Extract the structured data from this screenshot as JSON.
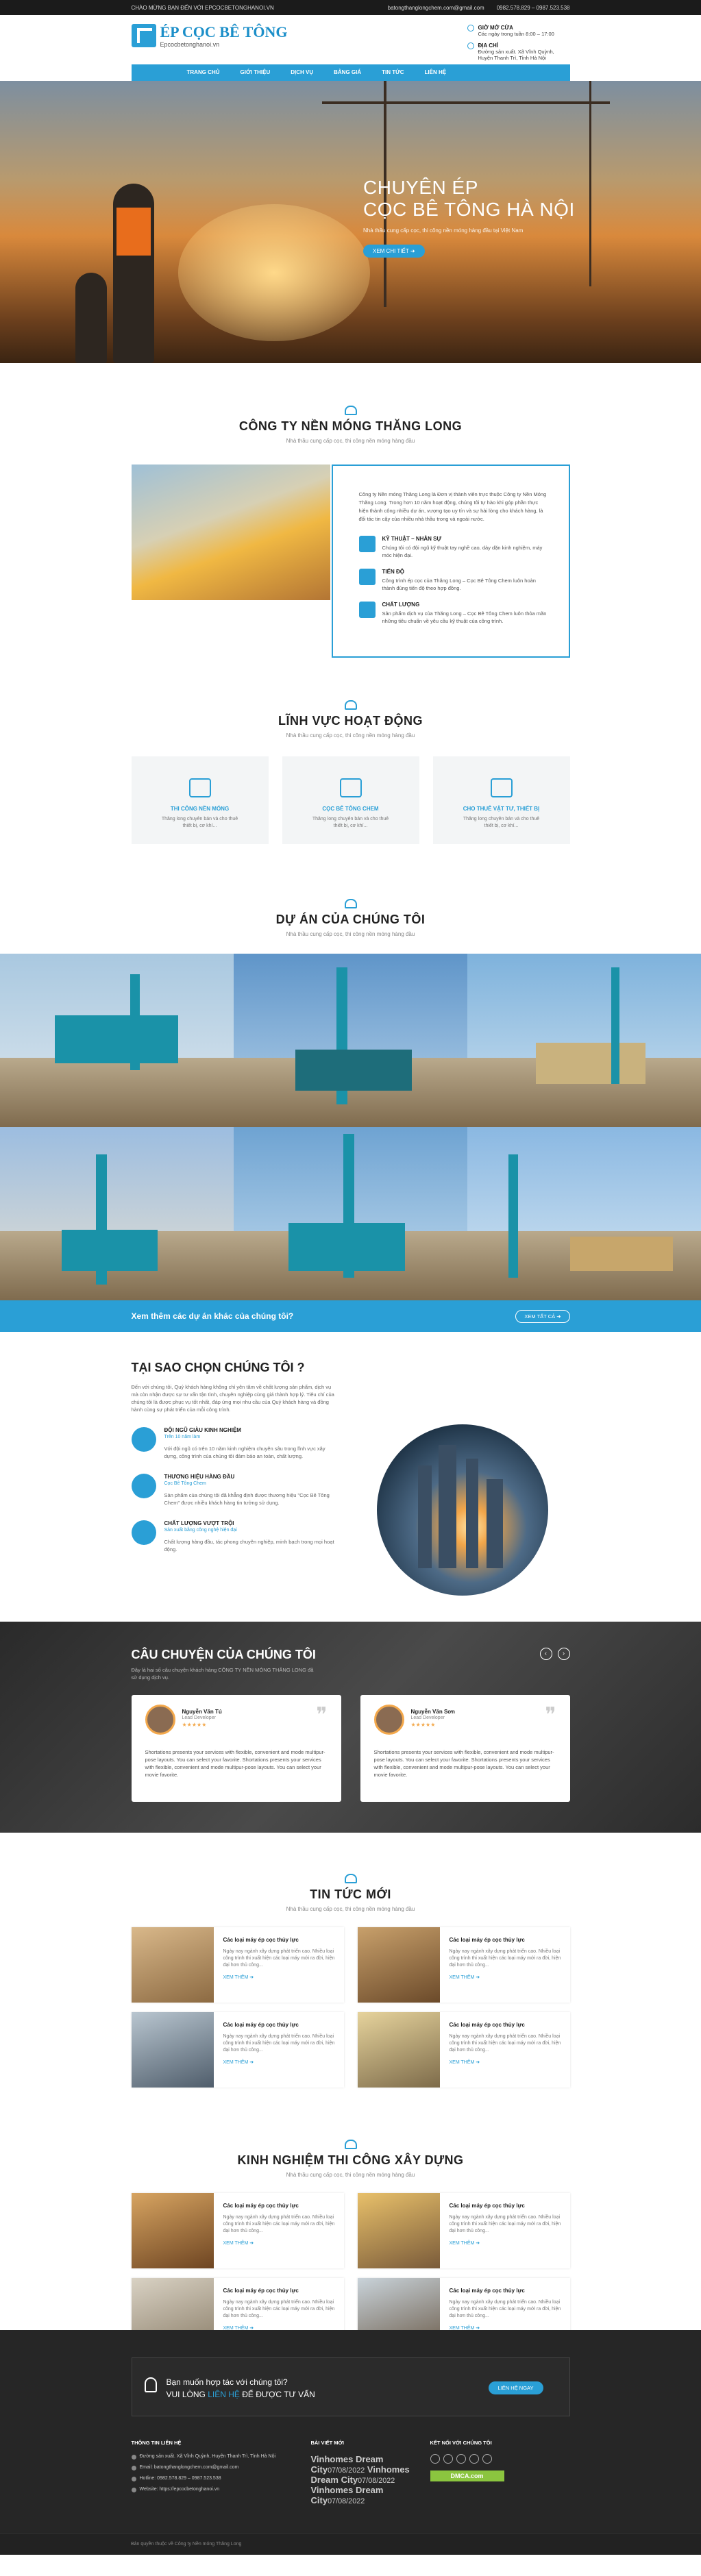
{
  "topbar": {
    "welcome": "CHÀO MỪNG BẠN ĐẾN VỚI EPCOCBETONGHANOI.VN",
    "email": "batongthanglongchem.com@gmail.com",
    "phone": "0982.578.829 – 0987.523.538"
  },
  "header": {
    "logo_title": "ÉP CỌC BÊ TÔNG",
    "logo_sub": "Epcocbetonghanoi.vn",
    "hours_title": "GIỜ MỞ CỬA",
    "hours_text": "Các ngày trong tuần 8:00 – 17:00",
    "address_title": "ĐỊA CHỈ",
    "address_text": "Đường sản xuất. Xã Vĩnh Quỳnh, Huyện Thanh Trì, Tỉnh Hà Nội"
  },
  "nav": [
    "TRANG CHỦ",
    "GIỚI THIỆU",
    "DỊCH VỤ",
    "BẢNG GIÁ",
    "TIN TỨC",
    "LIÊN HỆ"
  ],
  "hero": {
    "title_line1": "CHUYÊN ÉP",
    "title_line2": "CỌC BÊ TÔNG HÀ NỘI",
    "subtitle": "Nhà thầu cung cấp cọc, thi công nền móng hàng đầu tại Việt Nam",
    "button": "XEM CHI TIẾT ➜"
  },
  "about": {
    "title": "CÔNG TY NỀN MÓNG THĂNG LONG",
    "subtitle": "Nhà thầu cung cấp cọc, thi công nền móng hàng đầu",
    "intro": "Công ty Nền móng Thăng Long là Đơn vị thành viên trực thuộc Công ty Nền Móng Thăng Long. Trong hơn 10 năm hoạt động, chúng tôi tự hào khi góp phần thực hiện thành công nhiều dự án, vượng tạo uy tín và sự hài lòng cho khách hàng, là đối tác tin cậy của nhiều nhà thầu trong và ngoài nước.",
    "features": [
      {
        "title": "KỸ THUẬT – NHÂN SỰ",
        "text": "Chúng tôi có đội ngũ kỹ thuật tay nghề cao, dày dặn kinh nghiệm, máy móc hiện đại."
      },
      {
        "title": "TIẾN ĐỘ",
        "text": "Công trình ép cọc của Thăng Long – Cọc Bê Tông Chem luôn hoàn thành đúng tiến độ theo hợp đồng."
      },
      {
        "title": "CHẤT LƯỢNG",
        "text": "Sản phẩm dịch vụ của Thăng Long – Cọc Bê Tông Chem luôn thỏa mãn những tiêu chuẩn về yêu cầu kỹ thuật của công trình."
      }
    ]
  },
  "fields": {
    "title": "LĨNH VỰC HOẠT ĐỘNG",
    "subtitle": "Nhà thầu cung cấp cọc, thi công nền móng hàng đầu",
    "cards": [
      {
        "title": "THI CÔNG NỀN MÓNG",
        "text": "Thăng long chuyên bán và cho thuê thiết bị, cơ khí..."
      },
      {
        "title": "CỌC BÊ TÔNG CHEM",
        "text": "Thăng long chuyên bán và cho thuê thiết bị, cơ khí..."
      },
      {
        "title": "CHO THUÊ VẬT TƯ, THIẾT BỊ",
        "text": "Thăng long chuyên bán và cho thuê thiết bị, cơ khí..."
      }
    ]
  },
  "projects": {
    "title": "DỰ ÁN CỦA CHÚNG TÔI",
    "subtitle": "Nhà thầu cung cấp cọc, thi công nền móng hàng đầu",
    "more_text": "Xem thêm các dự án khác của chúng tôi?",
    "more_button": "XEM TẤT CẢ ➜"
  },
  "why": {
    "title": "TẠI SAO CHỌN CHÚNG TÔI ?",
    "lead": "Đến với chúng tôi, Quý khách hàng không chỉ yên tâm về chất lượng sản phẩm, dịch vụ mà còn nhận được sự tư vấn tận tình, chuyên nghiệp cùng giá thành hợp lý. Tiêu chí của chúng tôi là được phục vụ tốt nhất, đáp ứng mọi nhu cầu của Quý khách hàng và đồng hành cùng sự phát triển của mỗi công trình.",
    "reasons": [
      {
        "title": "ĐỘI NGŨ GIÀU KINH NGHIỆM",
        "tag": "Trên 10 năm làm",
        "text": "Với đội ngũ có trên 10 năm kinh nghiệm chuyên sâu trong lĩnh vực xây dựng, công trình của chúng tôi đảm bảo an toàn, chất lượng."
      },
      {
        "title": "THƯƠNG HIỆU HÀNG ĐẦU",
        "tag": "Cọc Bê Tông Chem",
        "text": "Sản phẩm của chúng tôi đã khẳng định được thương hiệu \"Cọc Bê Tông Chem\" được nhiều khách hàng tin tưởng sử dụng."
      },
      {
        "title": "CHẤT LƯỢNG VƯỢT TRỘI",
        "tag": "Sản xuất bằng công nghệ hiện đại",
        "text": "Chất lượng hàng đầu, tác phong chuyên nghiệp, minh bạch trong mọi hoạt động."
      }
    ]
  },
  "testimonials": {
    "title": "CÂU CHUYỆN CỦA CHÚNG TÔI",
    "lead": "Đây là hai số câu chuyện khách hàng CÔNG TY NỀN MÓNG THĂNG LONG đã sử dụng dịch vụ.",
    "items": [
      {
        "name": "Nguyễn Văn Tú",
        "role": "Lead Developer",
        "stars": "★★★★★",
        "text": "Shortations presents your services with flexible, convenient and mode multipur-pose layouts. You can select your favorite. Shortations presents your services with flexible, convenient and mode multipur-pose layouts. You can select your movie favorite."
      },
      {
        "name": "Nguyễn Văn Sơn",
        "role": "Lead Developer",
        "stars": "★★★★★",
        "text": "Shortations presents your services with flexible, convenient and mode multipur-pose layouts. You can select your favorite. Shortations presents your services with flexible, convenient and mode multipur-pose layouts. You can select your movie favorite."
      }
    ]
  },
  "news": {
    "title": "TIN TỨC MỚI",
    "subtitle": "Nhà thầu cung cấp cọc, thi công nền móng hàng đầu",
    "items": [
      {
        "title": "Các loại máy ép cọc thủy lực",
        "text": "Ngày nay ngành xây dựng phát triển cao. Nhiều loại công trình thi xuất hiện các loại máy mới ra đời, hiện đại hơn thủ công...",
        "link": "XEM THÊM ➜"
      },
      {
        "title": "Các loại máy ép cọc thủy lực",
        "text": "Ngày nay ngành xây dựng phát triển cao. Nhiều loại công trình thi xuất hiện các loại máy mới ra đời, hiện đại hơn thủ công...",
        "link": "XEM THÊM ➜"
      },
      {
        "title": "Các loại máy ép cọc thủy lực",
        "text": "Ngày nay ngành xây dựng phát triển cao. Nhiều loại công trình thi xuất hiện các loại máy mới ra đời, hiện đại hơn thủ công...",
        "link": "XEM THÊM ➜"
      },
      {
        "title": "Các loại máy ép cọc thủy lực",
        "text": "Ngày nay ngành xây dựng phát triển cao. Nhiều loại công trình thi xuất hiện các loại máy mới ra đời, hiện đại hơn thủ công...",
        "link": "XEM THÊM ➜"
      }
    ]
  },
  "experience": {
    "title": "KINH NGHIỆM THI CÔNG XÂY DỰNG",
    "subtitle": "Nhà thầu cung cấp cọc, thi công nền móng hàng đầu",
    "items": [
      {
        "title": "Các loại máy ép cọc thủy lực",
        "text": "Ngày nay ngành xây dựng phát triển cao. Nhiều loại công trình thi xuất hiện các loại máy mới ra đời, hiện đại hơn thủ công...",
        "link": "XEM THÊM ➜"
      },
      {
        "title": "Các loại máy ép cọc thủy lực",
        "text": "Ngày nay ngành xây dựng phát triển cao. Nhiều loại công trình thi xuất hiện các loại máy mới ra đời, hiện đại hơn thủ công...",
        "link": "XEM THÊM ➜"
      },
      {
        "title": "Các loại máy ép cọc thủy lực",
        "text": "Ngày nay ngành xây dựng phát triển cao. Nhiều loại công trình thi xuất hiện các loại máy mới ra đời, hiện đại hơn thủ công...",
        "link": "XEM THÊM ➜"
      },
      {
        "title": "Các loại máy ép cọc thủy lực",
        "text": "Ngày nay ngành xây dựng phát triển cao. Nhiều loại công trình thi xuất hiện các loại máy mới ra đời, hiện đại hơn thủ công...",
        "link": "XEM THÊM ➜"
      }
    ]
  },
  "footer": {
    "cta_line1": "Bạn muốn hợp tác với chúng tôi?",
    "cta_line2_pre": "VUI LÒNG ",
    "cta_line2_hl": "LIÊN HỆ",
    "cta_line2_post": " ĐỂ ĐƯỢC TƯ VẤN",
    "cta_button": "LIÊN HỆ NGAY",
    "contact_title": "THÔNG TIN LIÊN HỆ",
    "contact": [
      "Đường sản xuất. Xã Vĩnh Quỳnh, Huyện Thanh Trì, Tỉnh Hà Nội",
      "Email: batongthanglongchem.com@gmail.com",
      "Hotline: 0982.578.829 – 0987.523.538",
      "Website: https://epcocbetonghanoi.vn"
    ],
    "posts_title": "BÀI VIẾT MỚI",
    "posts": [
      {
        "title": "Vinhomes Dream City",
        "date": "07/08/2022"
      },
      {
        "title": "Vinhomes Dream City",
        "date": "07/08/2022"
      },
      {
        "title": "Vinhomes Dream City",
        "date": "07/08/2022"
      }
    ],
    "social_title": "KẾT NỐI VỚI CHÚNG TÔI",
    "dmca": "DMCA.com",
    "copyright": "Bản quyền thuộc về Công ty Nền móng Thăng Long"
  },
  "colors": {
    "accent": "#2a9fd6",
    "dark": "#262626",
    "star": "#f3a84b"
  }
}
